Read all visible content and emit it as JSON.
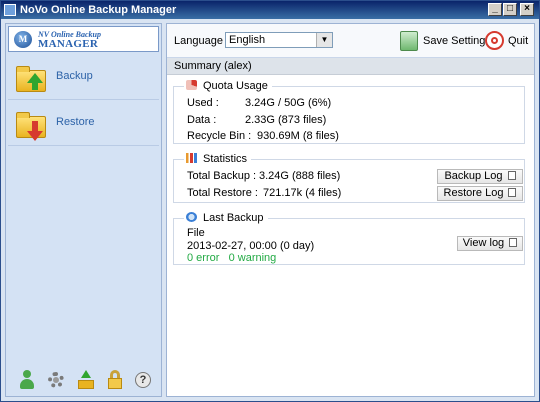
{
  "window": {
    "title": "NoVo Online Backup Manager",
    "controls": {
      "minimize": "_",
      "maximize": "□",
      "close": "×"
    }
  },
  "logo": {
    "line1": "NV Online Backup",
    "line2": "MANAGER",
    "mark": "M"
  },
  "sidebar": {
    "items": [
      {
        "label": "Backup",
        "icon": "folder-upload-icon"
      },
      {
        "label": "Restore",
        "icon": "folder-download-icon"
      }
    ],
    "bottom_icons": [
      "user-icon",
      "gear-icon",
      "upload-icon",
      "lock-icon",
      "help-icon"
    ],
    "help_glyph": "?"
  },
  "toolbar": {
    "language_label": "Language :",
    "language_value": "English",
    "save_label": "Save Setting",
    "quit_label": "Quit"
  },
  "summary": {
    "header": "Summary (alex)",
    "quota": {
      "title": "Quota Usage",
      "used_label": "Used :",
      "used_value": "3.24G / 50G (6%)",
      "data_label": "Data :",
      "data_value": "2.33G  (873 files)",
      "recycle_label": "Recycle Bin :",
      "recycle_value": "930.69M  (8 files)"
    },
    "statistics": {
      "title": "Statistics",
      "backup_label": "Total Backup :",
      "backup_value": "3.24G  (888 files)",
      "restore_label": "Total Restore :",
      "restore_value": "721.17k  (4 files)",
      "backup_log_button": "Backup Log",
      "restore_log_button": "Restore Log"
    },
    "last_backup": {
      "title": "Last Backup",
      "type": "File",
      "datetime": "2013-02-27, 00:00 (0 day)",
      "errors": "0 error",
      "warnings": "0 warning",
      "view_log_button": "View log"
    }
  },
  "colors": {
    "accent": "#2d63a8",
    "sidebar_bg": "#d4e2f4",
    "success": "#22aa44",
    "quit": "#d63a2f"
  }
}
